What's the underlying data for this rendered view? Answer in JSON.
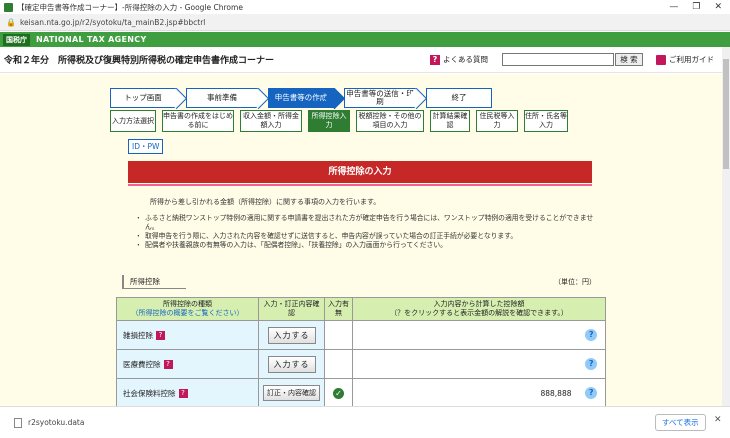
{
  "browser": {
    "title": "【確定申告書等作成コーナー】-所得控除の入力 - Google Chrome",
    "url": "keisan.nta.go.jp/r2/syotoku/ta_mainB2.jsp#bbctrl",
    "window_buttons": [
      "—",
      "❐",
      "✕"
    ]
  },
  "header": {
    "logo": "国税庁",
    "agency": "NATIONAL TAX AGENCY",
    "corner_title": "令和２年分　所得税及び復興特別所得税の確定申告書作成コーナー",
    "faq_label": "よくある質問",
    "search_placeholder": "",
    "search_button": "検 索",
    "guide_label": "ご利用ガイド"
  },
  "steps": [
    {
      "label": "トップ画面",
      "active": false
    },
    {
      "label": "事前準備",
      "active": false
    },
    {
      "label": "申告書等の作成",
      "active": true
    },
    {
      "label": "申告書等の送信・印刷",
      "active": false
    },
    {
      "label": "終了",
      "active": false
    }
  ],
  "substeps": [
    {
      "label": "入力方法選択",
      "active": false
    },
    {
      "label": "申告書の作成をはじめる前に",
      "active": false
    },
    {
      "label": "収入金額・所得金額入力",
      "active": false
    },
    {
      "label": "所得控除入力",
      "active": true
    },
    {
      "label": "税額控除・その他の項目の入力",
      "active": false
    },
    {
      "label": "計算結果確認",
      "active": false
    },
    {
      "label": "住民税等入力",
      "active": false
    },
    {
      "label": "住所・氏名等入力",
      "active": false
    }
  ],
  "idpw": "ID・PW",
  "page_title": "所得控除の入力",
  "intro": "所得から差し引かれる金額（所得控除）に関する事項の入力を行います。",
  "notes": [
    {
      "text": "ふるさと納税ワンストップ特例の適用に関する申請書を提出された方が確定申告を行う場合には、ワンストップ特例の適用を受けることができません。",
      "red": "確定申告を行う場合には、ワンストップ特例の適用を受けることができません。"
    },
    {
      "text": "取得申告を行う際に、入力された内容を確認せずに送信すると、申告内容が誤っていた場合の訂正手続が必要となります。",
      "red": ""
    },
    {
      "text": "配偶者や扶養親族の有無等の入力は、「配偶者控除」、「扶養控除」の入力画面から行ってください。",
      "red": ""
    }
  ],
  "section_label": "所得控除",
  "unit_label": "（単位：円）",
  "table": {
    "headers": {
      "type": "所得控除の種類",
      "type_sub": "（所得控除の概要をご覧ください）",
      "entry": "入力・訂正内容確認",
      "entered": "入力有無",
      "amount": "入力内容から計算した控除額",
      "amount_sub": "（？をクリックすると表示金額の解説を確認できます。）"
    },
    "rows": [
      {
        "name": "雑損控除",
        "button": "入力する",
        "entered": "",
        "amount": ""
      },
      {
        "name": "医療費控除",
        "button": "入力する",
        "entered": "",
        "amount": ""
      },
      {
        "name": "社会保険料控除",
        "button": "訂正・内容確認",
        "entered": "✓",
        "amount": "888,888"
      }
    ]
  },
  "downloads": {
    "file": "r2syotoku.data",
    "show_all": "すべて表示"
  },
  "colors": {
    "nta_green": "#3f9e3f",
    "active_step": "#1565c0",
    "banner_red": "#c62828"
  }
}
